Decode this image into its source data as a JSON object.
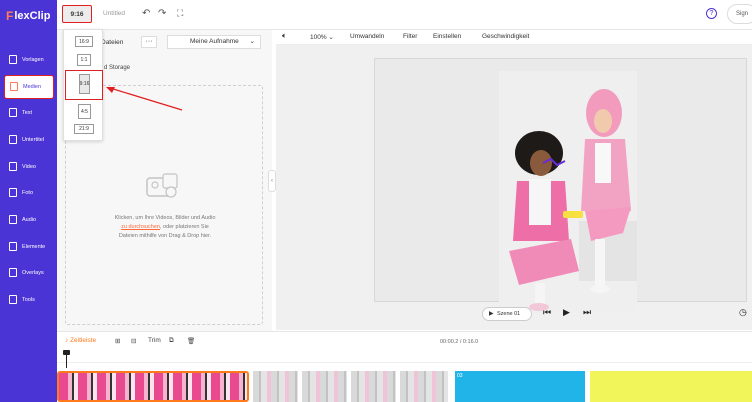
{
  "app": {
    "logo": "lexClip",
    "logo_mark": "F",
    "doc_title": "Untitled"
  },
  "topbar": {
    "ratio": "9:16",
    "login": "Sign"
  },
  "ratio_menu": [
    "16:9",
    "1:1",
    "9:16",
    "4:5",
    "21:9"
  ],
  "sidebar": {
    "items": [
      {
        "label": "Vorlagen"
      },
      {
        "label": "Medien"
      },
      {
        "label": "Text"
      },
      {
        "label": "Untertitel"
      },
      {
        "label": "Video"
      },
      {
        "label": "Foto"
      },
      {
        "label": "Audio"
      },
      {
        "label": "Elemente"
      },
      {
        "label": "Overlays"
      },
      {
        "label": "Tools"
      }
    ]
  },
  "panel": {
    "files_tab": "Dateien",
    "more": "···",
    "recording_select": "Meine Aufnahme",
    "storage_label": "d Storage",
    "drop_text_1": "Klicken, um Ihre Videos, Bilder und Audio",
    "drop_link": "zu durchsuchen",
    "drop_text_2": ", oder platzieren Sie",
    "drop_text_3": "Dateien mithilfe von Drag & Drop hier."
  },
  "editor_toolbar": {
    "zoom": "100%",
    "transform": "Umwandeln",
    "filter": "Filter",
    "adjust": "Einstellen",
    "speed": "Geschwindigkeit"
  },
  "stage": {
    "scene": "Szene 01"
  },
  "timeline": {
    "timeline_btn": "Zeitleiste",
    "trim": "Trim",
    "time": "00:00.2 / 0:16.0",
    "blue_badge": "03"
  }
}
